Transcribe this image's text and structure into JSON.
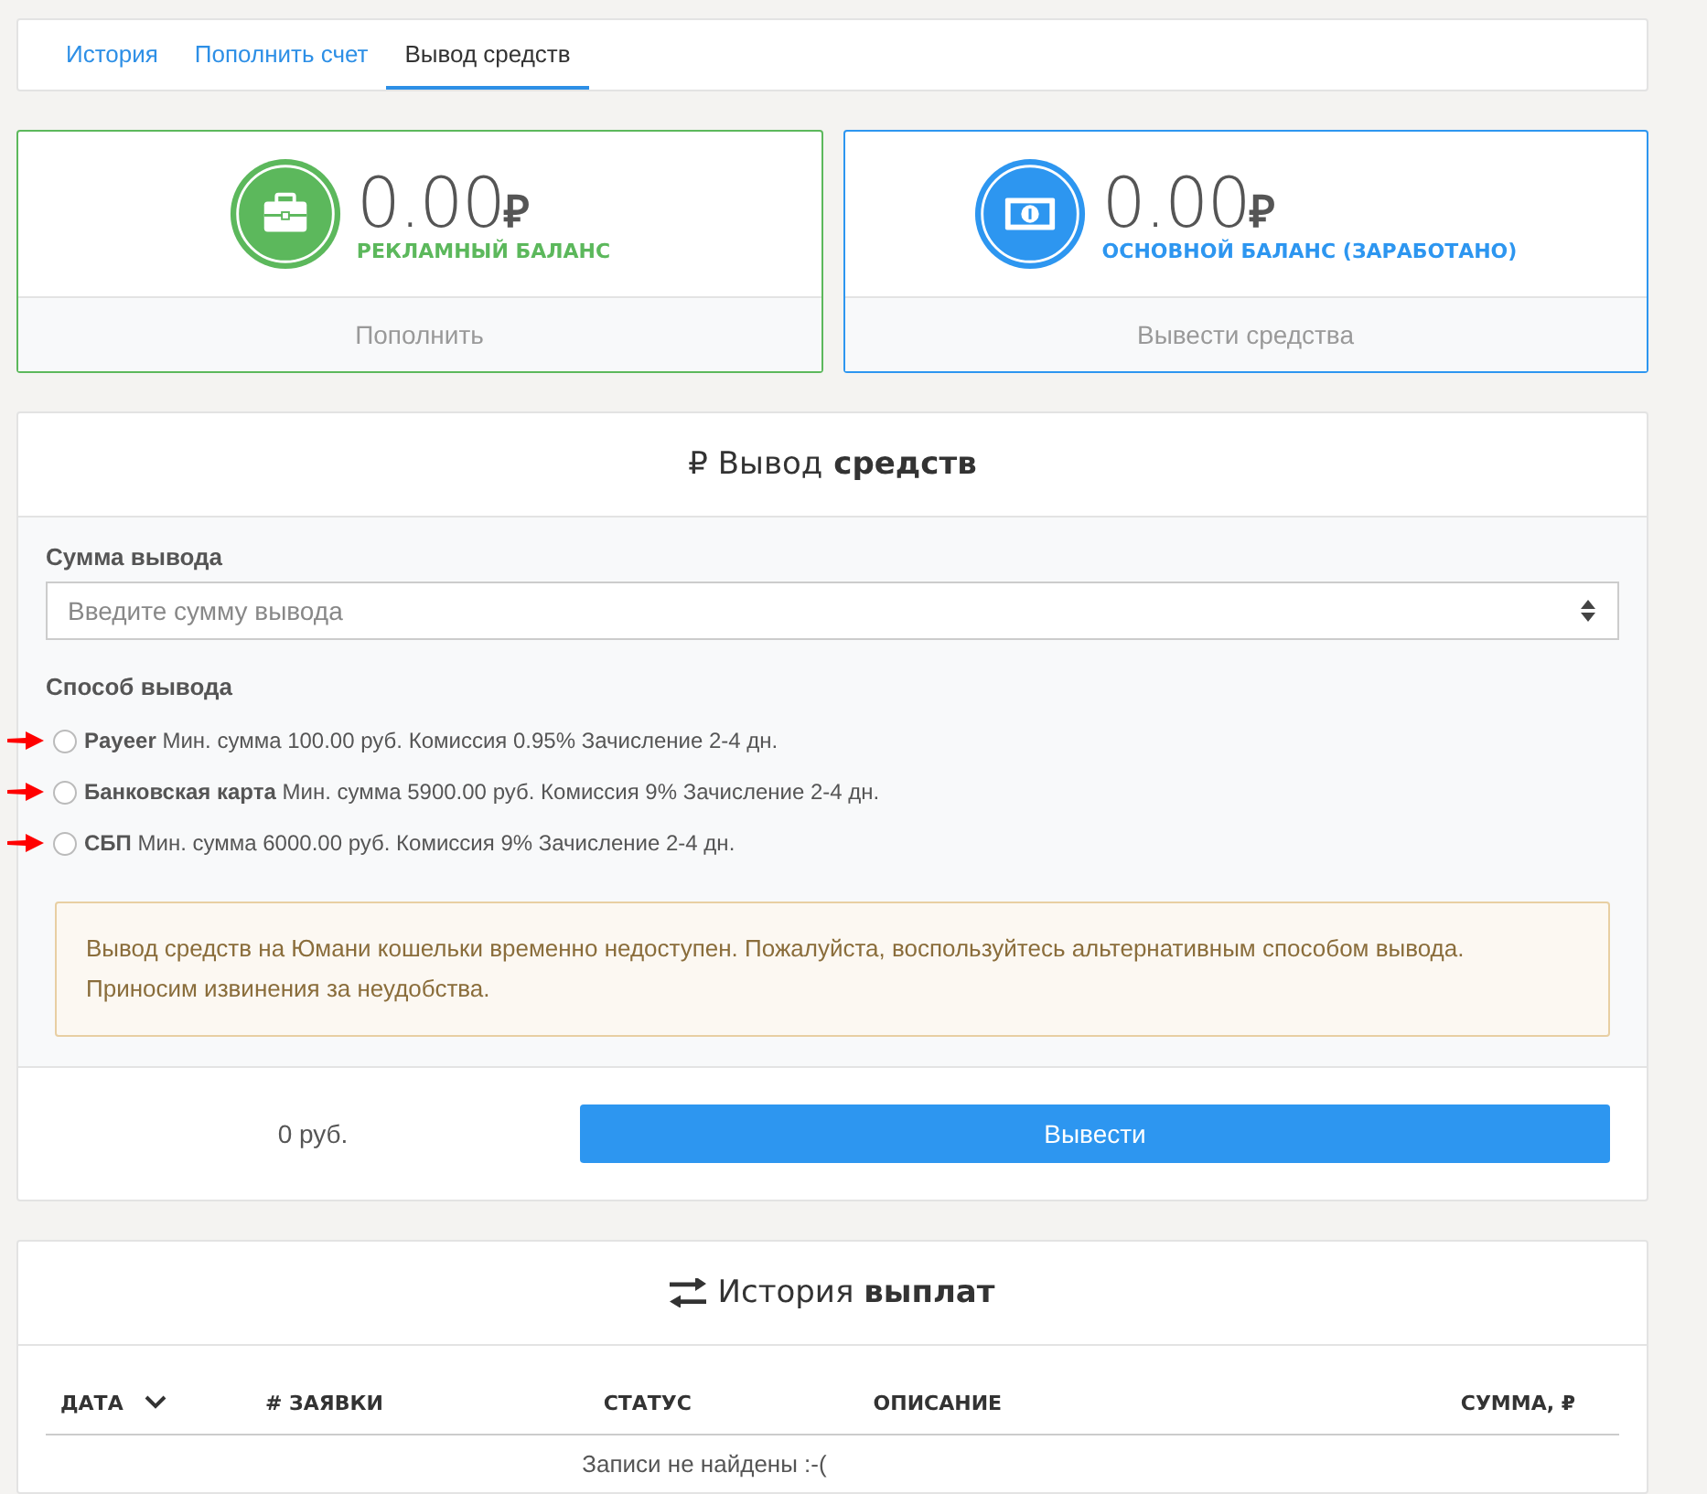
{
  "tabs": [
    {
      "label": "История",
      "selected": false
    },
    {
      "label": "Пополнить счет",
      "selected": false
    },
    {
      "label": "Вывод средств",
      "selected": true
    }
  ],
  "balances": [
    {
      "amount": "0.00",
      "currency": "₽",
      "label": "РЕКЛАМНЫЙ БАЛАНС",
      "action": "Пополнить",
      "color": "#5cb85c"
    },
    {
      "amount": "0.00",
      "currency": "₽",
      "label": "ОСНОВНОЙ БАЛАНС (ЗАРАБОТАНО)",
      "action": "Вывести средства",
      "color": "#2d96f0"
    }
  ],
  "withdraw": {
    "title": "₽ Вывод **средств**",
    "amount_label": "Сумма вывода",
    "amount_field": {
      "placeholder": "Введите сумму вывода"
    },
    "method_label": "Способ вывода",
    "methods": [
      {
        "text": "**Payeer** Мин. сумма 100.00 руб. Комиссия 0.95% Зачисление 2-4 дн.",
        "selected": false,
        "arrow": true
      },
      {
        "text": "**Банковская карта** Мин. сумма 5900.00 руб. Комиссия 9% Зачисление 2-4 дн.",
        "selected": false,
        "arrow": true
      },
      {
        "text": "**СБП** Мин. сумма 6000.00 руб. Комиссия 9% Зачисление 2-4 дн.",
        "selected": false,
        "arrow": true
      }
    ],
    "notice": "Вывод средств на Юмани кошельки временно недоступен. Пожалуйста, воспользуйтесь альтернативным способом вывода. Приносим извинения за неудобства.",
    "total": "0 руб.",
    "submit": "Вывести"
  },
  "history": {
    "title": "История **выплат**",
    "columns": [
      {
        "label": "ДАТА",
        "sortable": true
      },
      {
        "label": "# ЗАЯВКИ",
        "sortable": false
      },
      {
        "label": "СТАТУС",
        "sortable": false
      },
      {
        "label": "ОПИСАНИЕ",
        "sortable": false
      },
      {
        "label": "СУММА, ₽",
        "sortable": false
      }
    ],
    "empty": "Записи не найдены :-("
  }
}
